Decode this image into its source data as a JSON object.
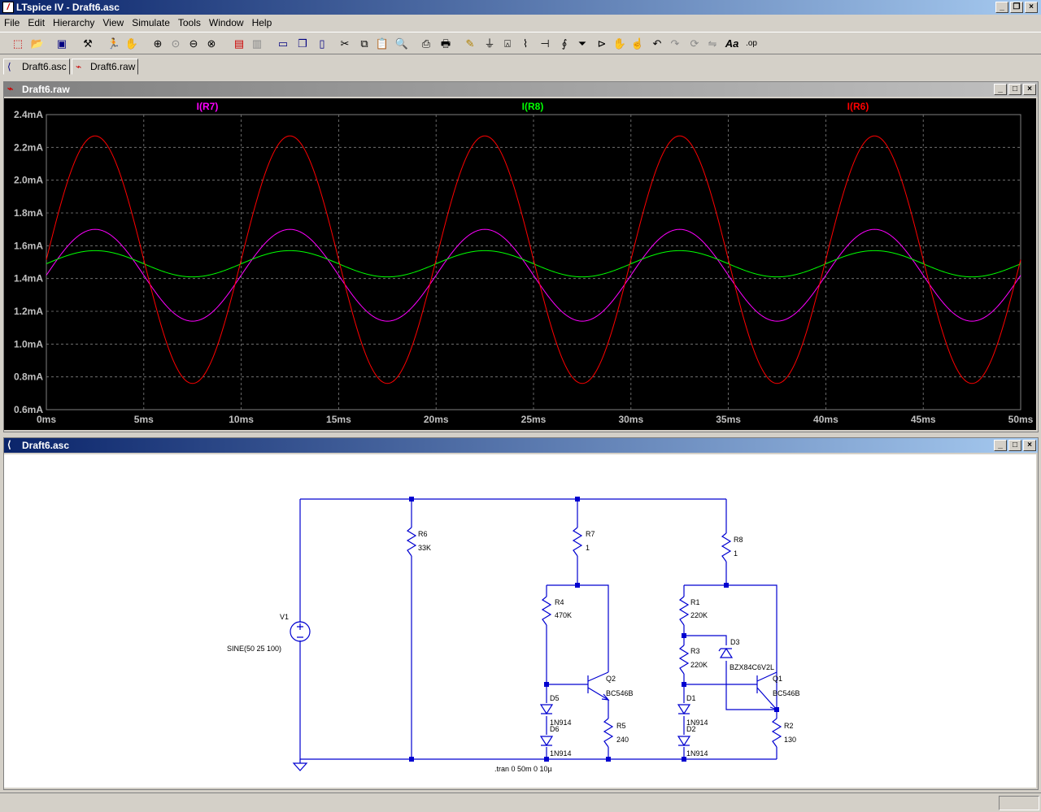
{
  "app": {
    "title": "LTspice IV - Draft6.asc"
  },
  "menu": [
    "File",
    "Edit",
    "Hierarchy",
    "View",
    "Simulate",
    "Tools",
    "Window",
    "Help"
  ],
  "tabs": [
    {
      "label": "Draft6.asc",
      "icon": "schematic-icon"
    },
    {
      "label": "Draft6.raw",
      "icon": "waveform-icon"
    }
  ],
  "waveform_window": {
    "title": "Draft6.raw"
  },
  "schematic_window": {
    "title": "Draft6.asc"
  },
  "chart_data": {
    "type": "line",
    "title": "",
    "xlabel": "",
    "ylabel": "",
    "xlim": [
      0,
      50
    ],
    "ylim": [
      0.6,
      2.4
    ],
    "x_unit": "ms",
    "y_unit": "mA",
    "x_ticks": [
      "0ms",
      "5ms",
      "10ms",
      "15ms",
      "20ms",
      "25ms",
      "30ms",
      "35ms",
      "40ms",
      "45ms",
      "50ms"
    ],
    "y_ticks": [
      "0.6mA",
      "0.8mA",
      "1.0mA",
      "1.2mA",
      "1.4mA",
      "1.6mA",
      "1.8mA",
      "2.0mA",
      "2.2mA",
      "2.4mA"
    ],
    "grid": true,
    "series": [
      {
        "name": "I(R7)",
        "color": "#ff00ff",
        "offset": 1.42,
        "amplitude": 0.28,
        "frequency_hz": 100
      },
      {
        "name": "I(R8)",
        "color": "#00ff00",
        "offset": 1.49,
        "amplitude": 0.08,
        "frequency_hz": 100
      },
      {
        "name": "I(R6)",
        "color": "#ff0000",
        "offset": 1.515,
        "amplitude": 0.755,
        "frequency_hz": 100
      }
    ]
  },
  "schematic": {
    "components": [
      {
        "ref": "R6",
        "value": "33K"
      },
      {
        "ref": "R7",
        "value": "1"
      },
      {
        "ref": "R8",
        "value": "1"
      },
      {
        "ref": "R4",
        "value": "470K"
      },
      {
        "ref": "R1",
        "value": "220K"
      },
      {
        "ref": "R3",
        "value": "220K"
      },
      {
        "ref": "R5",
        "value": "240"
      },
      {
        "ref": "R2",
        "value": "130"
      },
      {
        "ref": "V1",
        "value": "SINE(50 25 100)"
      },
      {
        "ref": "Q2",
        "value": "BC546B"
      },
      {
        "ref": "Q1",
        "value": "BC546B"
      },
      {
        "ref": "D5",
        "value": "1N914"
      },
      {
        "ref": "D6",
        "value": "1N914"
      },
      {
        "ref": "D1",
        "value": "1N914"
      },
      {
        "ref": "D2",
        "value": "1N914"
      },
      {
        "ref": "D3",
        "value": "BZX84C6V2L"
      }
    ],
    "directive": ".tran 0 50m 0 10µ"
  }
}
